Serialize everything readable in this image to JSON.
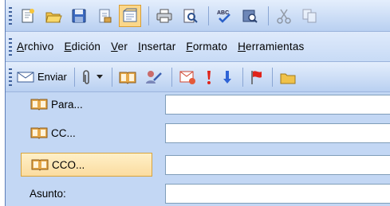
{
  "standard_toolbar": {
    "icons": [
      "new-icon",
      "open-icon",
      "save-icon",
      "permission-icon",
      "research-icon",
      "print-icon",
      "print-preview-icon",
      "spelling-icon",
      "research-book-icon",
      "cut-icon",
      "copy-icon"
    ]
  },
  "menu": {
    "items": [
      {
        "label": "Archivo",
        "accel": "A",
        "rest": "rchivo"
      },
      {
        "label": "Edición",
        "accel": "E",
        "rest": "dición"
      },
      {
        "label": "Ver",
        "accel": "V",
        "rest": "er"
      },
      {
        "label": "Insertar",
        "accel": "I",
        "rest": "nsertar"
      },
      {
        "label": "Formato",
        "accel": "F",
        "rest": "ormato"
      },
      {
        "label": "Herramientas",
        "accel": "H",
        "rest": "erramientas"
      }
    ]
  },
  "email_toolbar": {
    "send_label": "Enviar",
    "icons": [
      "attach-icon",
      "address-book-icon",
      "check-names-icon",
      "options-icon",
      "importance-high-icon",
      "importance-low-icon",
      "flag-icon",
      "insert-file-icon"
    ]
  },
  "address": {
    "to_label": "Para...",
    "cc_label": "CC...",
    "bcc_label": "CCO...",
    "subject_label": "Asunto:",
    "to_value": "",
    "cc_value": "",
    "bcc_value": "",
    "subject_value": ""
  },
  "colors": {
    "toolbar_top": "#e4eefc",
    "toolbar_bottom": "#b9d0f1",
    "selected_button": "#fbdca0",
    "address_background": "#c3d7f4"
  }
}
